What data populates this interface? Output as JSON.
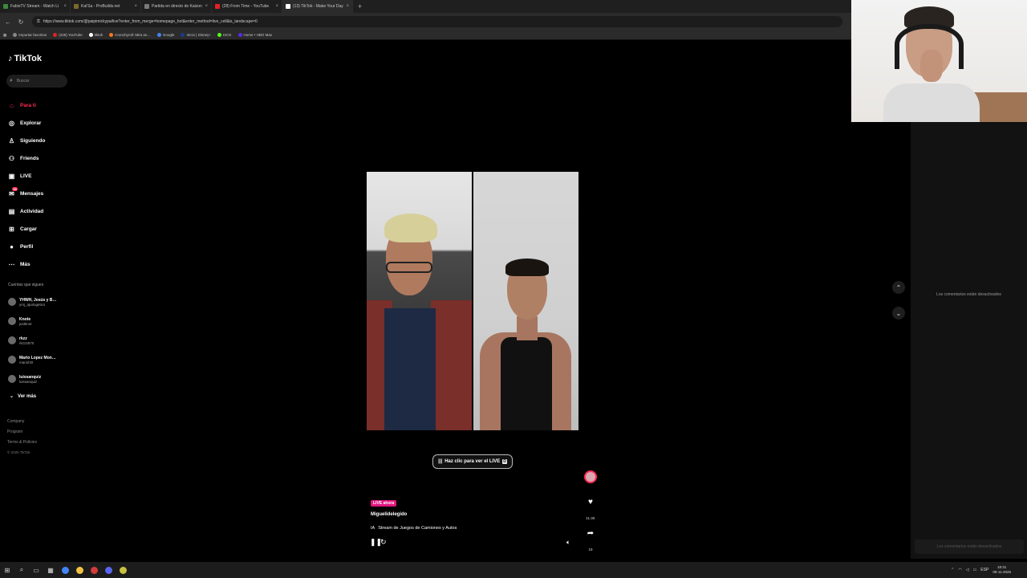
{
  "browser": {
    "tabs": [
      {
        "title": "FabioTV Stream - Watch Li",
        "color": "#3b8a3b",
        "active": false
      },
      {
        "title": "Kai'Sa - ProBuilds.net",
        "color": "#7a6a2a",
        "active": false
      },
      {
        "title": "Partida en directo de Kaizone#4…",
        "color": "#7a7a7a",
        "active": false
      },
      {
        "title": "(28) From Time - YouTube",
        "color": "#e02424",
        "active": false
      },
      {
        "title": "(13) TikTok - Make Your Day",
        "color": "#ffffff",
        "active": true
      }
    ],
    "new_tab": "+",
    "url": "https://www.tiktok.com/@paipimickypa/live?enter_from_merge=homepage_hot&enter_method=live_cell&is_landscape=0",
    "bookmarks": [
      {
        "label": "Importar favoritos",
        "color": "#888888"
      },
      {
        "label": "(228) YouTube",
        "color": "#e02424"
      },
      {
        "label": "tiktok",
        "color": "#ffffff"
      },
      {
        "label": "Crunchyroll: Mira an…",
        "color": "#f47521"
      },
      {
        "label": "Google",
        "color": "#4285f4"
      },
      {
        "label": "Inicio | Disney+",
        "color": "#1b3a8f"
      },
      {
        "label": "KICK",
        "color": "#53fc18"
      },
      {
        "label": "Home • HBO Max",
        "color": "#5a2be2"
      }
    ]
  },
  "sidebar": {
    "logo": "TikTok",
    "search_placeholder": "Buscar",
    "nav": [
      {
        "label": "Para ti",
        "icon": "home-icon",
        "glyph": "⌂",
        "active": true
      },
      {
        "label": "Explorar",
        "icon": "compass-icon",
        "glyph": "◎",
        "active": false
      },
      {
        "label": "Siguiendo",
        "icon": "following-icon",
        "glyph": "♙",
        "active": false
      },
      {
        "label": "Friends",
        "icon": "friends-icon",
        "glyph": "⚇",
        "active": false
      },
      {
        "label": "LIVE",
        "icon": "live-icon",
        "glyph": "▣",
        "active": false
      },
      {
        "label": "Mensajes",
        "icon": "message-icon",
        "glyph": "✉",
        "active": false,
        "badge": "15"
      },
      {
        "label": "Actividad",
        "icon": "activity-icon",
        "glyph": "▤",
        "active": false
      },
      {
        "label": "Cargar",
        "icon": "upload-icon",
        "glyph": "⊞",
        "active": false
      },
      {
        "label": "Perfil",
        "icon": "profile-icon",
        "glyph": "●",
        "active": false
      },
      {
        "label": "Más",
        "icon": "more-icon",
        "glyph": "⋯",
        "active": false
      }
    ],
    "following_title": "Cuentas que sigues",
    "following": [
      {
        "name": "YHWH, Jesús y B…",
        "handle": "ymj_apologetics"
      },
      {
        "name": "Knote",
        "handle": "justknot"
      },
      {
        "name": "rkzz",
        "handle": "rkzz2870"
      },
      {
        "name": "Mario Lopez Mon…",
        "handle": "mariol30"
      },
      {
        "name": "luissanquiz",
        "handle": "luissanquiz"
      }
    ],
    "see_more": "Ver más",
    "footer_links": [
      "Company",
      "Program",
      "Terms & Policies"
    ],
    "copyright": "© 2025 TikTok"
  },
  "live": {
    "watch_button": "Haz clic para ver el LIVE",
    "watch_key": "D",
    "badge": "LIVE ahora",
    "host": "Miguelidelegido",
    "title_prefix": "IA",
    "title": "Stream de Juegos de Camiones y Autos",
    "like_count": "11.3K",
    "share_count": "19"
  },
  "comments": {
    "disabled_message": "Los comentarios están desactivados",
    "input_placeholder": "Los comentarios están desactivados"
  },
  "taskbar": {
    "apps": [
      {
        "icon": "windows-start-icon",
        "glyph": "⊞",
        "color": ""
      },
      {
        "icon": "search-icon",
        "glyph": "⌕",
        "color": ""
      },
      {
        "icon": "task-view-icon",
        "glyph": "▭",
        "color": ""
      },
      {
        "icon": "widgets-icon",
        "glyph": "▦",
        "color": ""
      },
      {
        "icon": "chrome-icon",
        "glyph": "",
        "color": "#4285f4"
      },
      {
        "icon": "file-explorer-icon",
        "glyph": "",
        "color": "#f3c244"
      },
      {
        "icon": "game-launcher-icon",
        "glyph": "",
        "color": "#d23b3b"
      },
      {
        "icon": "discord-icon",
        "glyph": "",
        "color": "#5865f2"
      },
      {
        "icon": "app-icon",
        "glyph": "",
        "color": "#c8c040"
      }
    ],
    "lang": "ESP",
    "time": "18:31",
    "date": "08-11-2025"
  }
}
